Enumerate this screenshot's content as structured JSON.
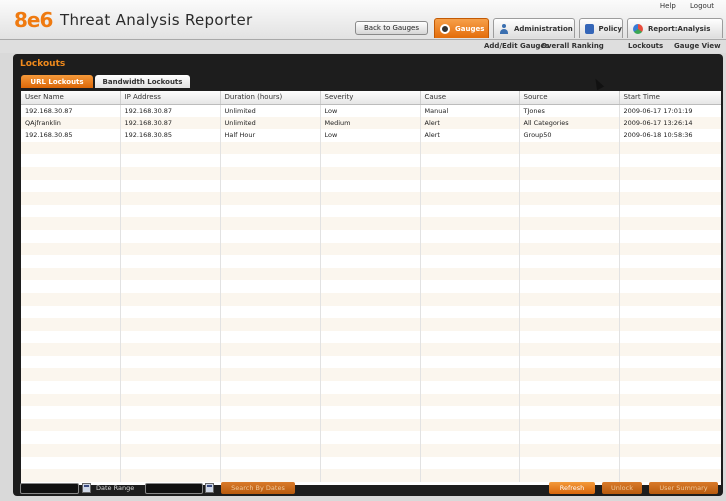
{
  "app": {
    "logo": "8e6",
    "title": "Threat Analysis Reporter"
  },
  "top_links": {
    "help": "Help",
    "logout": "Logout"
  },
  "back_button": "Back to Gauges",
  "main_tabs": [
    {
      "label": "Gauges",
      "icon": "gauge-icon",
      "active": true
    },
    {
      "label": "Administration",
      "icon": "user-icon",
      "active": false
    },
    {
      "label": "Policy",
      "icon": "policy-icon",
      "active": false
    },
    {
      "label": "Report:Analysis",
      "icon": "report-icon",
      "active": false
    }
  ],
  "sub_nav": [
    "Add/Edit Gauges",
    "Overall Ranking",
    "Lockouts",
    "Gauge View"
  ],
  "panel": {
    "title": "Lockouts",
    "tabs": [
      {
        "label": "URL Lockouts",
        "active": true
      },
      {
        "label": "Bandwidth Lockouts",
        "active": false
      }
    ]
  },
  "table": {
    "columns": [
      "User Name",
      "IP Address",
      "Duration (hours)",
      "Severity",
      "Cause",
      "Source",
      "Start Time"
    ],
    "rows": [
      [
        "192.168.30.87",
        "192.168.30.87",
        "Unlimited",
        "Low",
        "Manual",
        "TJones",
        "2009-06-17 17:01:19"
      ],
      [
        "QAjfranklin",
        "192.168.30.87",
        "Unlimited",
        "Medium",
        "Alert",
        "All Categories",
        "2009-06-17 13:26:14"
      ],
      [
        "192.168.30.85",
        "192.168.30.85",
        "Half Hour",
        "Low",
        "Alert",
        "Group50",
        "2009-06-18 10:58:36"
      ]
    ]
  },
  "footer": {
    "date_range_label": "Date Range",
    "search_button": "Search By Dates",
    "refresh_button": "Refresh",
    "unlock_button": "Unlock",
    "summary_button": "User Summary"
  },
  "colors": {
    "accent_orange": "#e36c0a",
    "panel_dark": "#1d1d1d",
    "title_orange": "#f08a1c"
  }
}
